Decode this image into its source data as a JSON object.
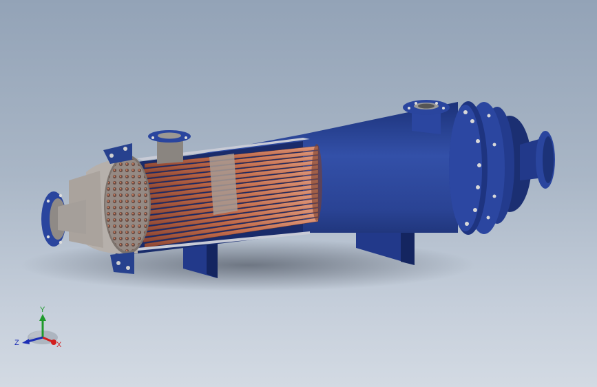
{
  "viewport": {
    "background_top": "#93a3b7",
    "background_bottom": "#d3dae3"
  },
  "model": {
    "shell_color": "#27418e",
    "tube_color": "#c06a4a",
    "tubesheet_color": "#8b7f78"
  },
  "triad": {
    "x_label": "X",
    "y_label": "Y",
    "z_label": "Z",
    "x_color": "#d21e1e",
    "y_color": "#1f9a2c",
    "z_color": "#1d2fb5"
  }
}
